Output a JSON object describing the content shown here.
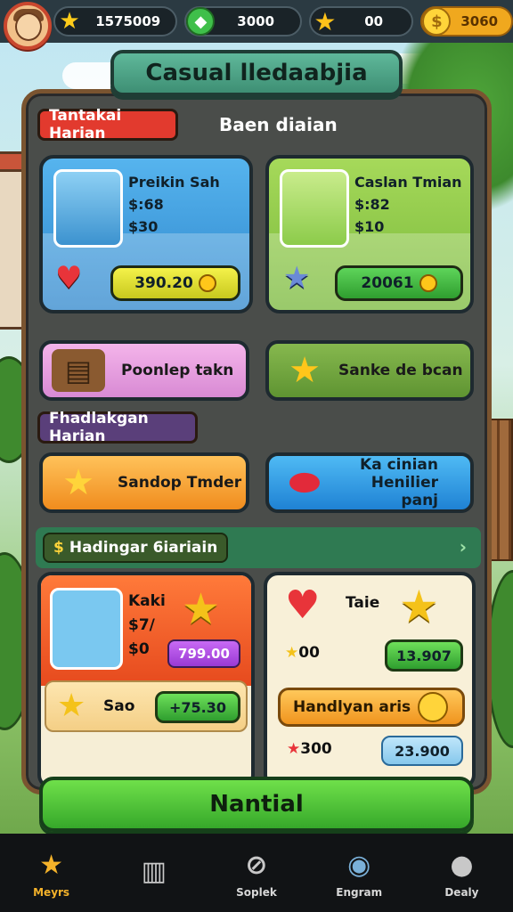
{
  "top_bar": {
    "resources": [
      {
        "icon": "star-icon",
        "value": "1575009"
      },
      {
        "icon": "green-gem-icon",
        "value": "3000"
      },
      {
        "icon": "gold-star-icon",
        "value": "00"
      },
      {
        "icon": "gold-coin-icon",
        "value": "3060"
      }
    ]
  },
  "title": "Casual lledaabjia",
  "section1": {
    "tag_red": "Tantakai Harian",
    "tag_plain": "Baen diaian"
  },
  "offer_cards": [
    {
      "name": "Preikin Sah",
      "line2": "$:68",
      "line3": "$30",
      "price": "390.20"
    },
    {
      "name": "Caslan Tmian",
      "line2": "$:82",
      "line3": "$10",
      "price": "20061"
    }
  ],
  "pills_row1": [
    {
      "label": "Poonlep takn"
    },
    {
      "label": "Sanke de bcan"
    }
  ],
  "tag_purple": "Fhadlakgan Harian",
  "pills_row2": [
    {
      "label": "Sandop Tmder"
    },
    {
      "label_line1": "Ka cinian",
      "label_line2": "Henilier panj"
    }
  ],
  "banner": {
    "label": "Hadingar 6iariain"
  },
  "left_card": {
    "name": "Kaki",
    "line2": "$7/",
    "line3": "$0",
    "price": "799.00",
    "sale_label": "Sao",
    "sale_price": "75.30"
  },
  "right_card": {
    "label": "Taie",
    "stars": "00",
    "price": "13.907",
    "orange_label": "Handlyan aris",
    "hearts": "300",
    "blue_price": "23.900"
  },
  "cta": "Nantial",
  "nav": [
    {
      "label": "Meyrs",
      "icon": "home-star-icon",
      "active": true
    },
    {
      "label": "",
      "icon": "door-icon",
      "active": false
    },
    {
      "label": "Soplek",
      "icon": "tool-icon",
      "active": false
    },
    {
      "label": "Engram",
      "icon": "camera-icon",
      "active": false
    },
    {
      "label": "Dealy",
      "icon": "person-icon",
      "active": false
    }
  ],
  "colors": {
    "accent_green": "#36a82a",
    "accent_orange": "#f0941e",
    "nav_active": "#f4b22a",
    "panel": "#4a4d4a"
  }
}
